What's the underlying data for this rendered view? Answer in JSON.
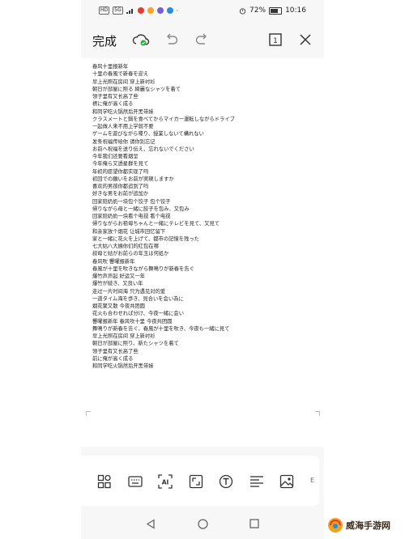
{
  "status_bar": {
    "left_chips": [
      "HD",
      "5G"
    ],
    "battery": "72%",
    "time": "10:16"
  },
  "toolbar": {
    "done_label": "完成"
  },
  "document": {
    "lines": [
      "春风十里报新年",
      "十里の春風で新春を迎え",
      "早上光照在房间 穿上新衬衫",
      "朝日が部屋に照る 綺麗なシャツを着て",
      "领子里有又长高了些",
      "襟に俺が高く成る",
      "和同学吃火锅然后开黑带妹",
      "クラスメートと鍋を食べてからマイカー運転しながらドライブ",
      "一起做人来不用上学就不要",
      "ゲームを遊びながら喋り、授業しないて構れない",
      "发条祝福传给你 请你别忘记",
      "お前へ祝福を送り伝え、忘れないでください",
      "今年我们还要看烟呈",
      "今年俺ら又透星群を見て",
      "年初的愿望你都实现了吗",
      "初回での願いをお前が実現しますか",
      "喜欢的男孩你都追到了吗",
      "好きな男をお前が追加か",
      "回家陪奶奶一块包个饺子 包个饺子",
      "帰りながら母と一緒に餃子を包み、又包み",
      "回家陪奶奶一块看个电视 看个电视",
      "帰りながらお祖母ちゃんと一緒にテレビを見て、又見て",
      "和亲家放个烟花 让城市回忆留下",
      "家と一緒に花火を上げて、都市の記憶を残った",
      "七大姑八大姨你们的红包在哪",
      "叔母と姑がお前らの年玉は何処か",
      "春风吹 響曜报新年",
      "春風が十里を吹きながら舞鳴りが新春を告ぐ",
      "爆竹声声起 好运又一年",
      "爆竹が続き、又良い年",
      "走过一片时间海 只为遇见对的爱",
      "一道タイム海を歩き、見合いを会い為に",
      "烟花聚又散 今夜共团圆",
      "花火も合わせれば分け、今夜一緒に会い",
      "響曜报新年 春风吹十里 今夜共团圆",
      "舞鳴りが新春を告ぐ、春風が十里を吹き、今夜も一緒に見て",
      "早上光照在房间 穿上新衬衫",
      "朝日が部屋に照り、新たシャツを着て",
      "领子里有又长高了些",
      "前に俺が高く成る",
      "和同学吃火锅然后开黑带妹"
    ]
  },
  "bottom_toolbar": {
    "icons": [
      "layout-icon",
      "keyboard-icon",
      "ai-icon",
      "crop-icon",
      "text-icon",
      "align-icon",
      "image-icon"
    ],
    "edge_glyph": "E"
  },
  "watermark": {
    "text": "威海手游网"
  }
}
